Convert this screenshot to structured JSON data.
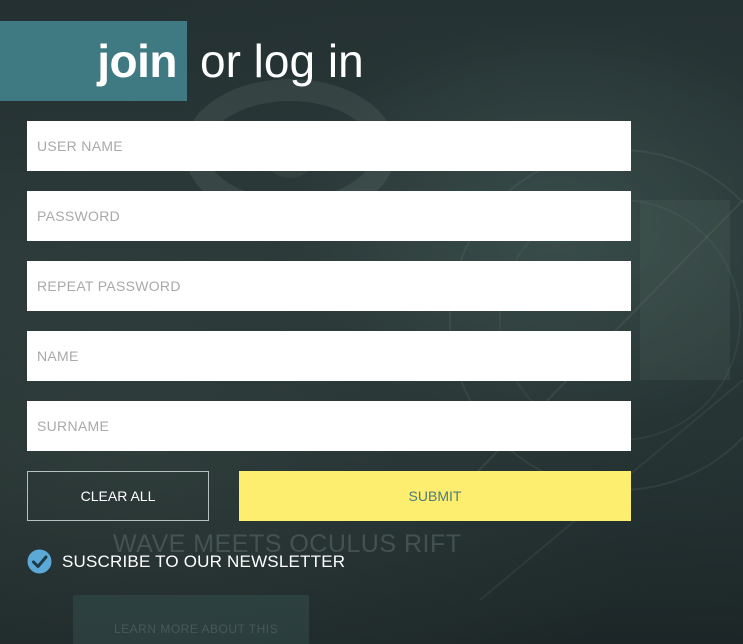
{
  "header": {
    "join": "join",
    "login": "or log in"
  },
  "form": {
    "username_placeholder": "USER NAME",
    "password_placeholder": "PASSWORD",
    "repeat_password_placeholder": "REPEAT PASSWORD",
    "name_placeholder": "NAME",
    "surname_placeholder": "SURNAME"
  },
  "buttons": {
    "clear_all": "CLEAR ALL",
    "submit": "SUBMIT"
  },
  "newsletter": {
    "label": "SUSCRIBE TO OUR NEWSLETTER",
    "checked": true
  },
  "background": {
    "headline": "WAVE MEETS OCULUS RIFT",
    "button_label": "LEARN MORE ABOUT THIS"
  },
  "colors": {
    "accent": "#3f7a82",
    "submit": "#fdee6f",
    "check": "#5aa9d6"
  }
}
